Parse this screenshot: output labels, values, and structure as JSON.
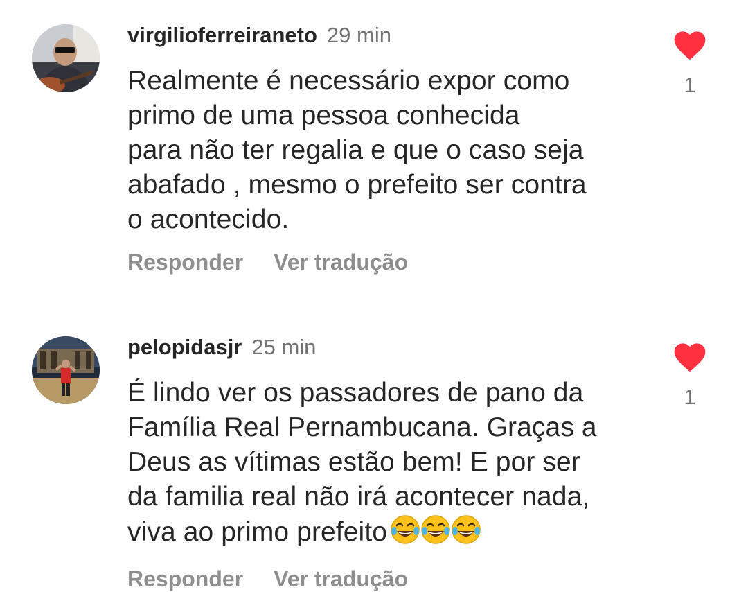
{
  "comments": [
    {
      "username": "virgilioferreiraneto",
      "time": "29 min",
      "lines": [
        "Realmente é necessário expor como",
        "primo de uma pessoa conhecida",
        "para não ter regalia e que o caso seja",
        "abafado , mesmo o prefeito ser contra",
        "o acontecido."
      ],
      "reply_label": "Responder",
      "translate_label": "Ver tradução",
      "like_count": "1",
      "liked": true,
      "like_color": "#ff3040"
    },
    {
      "username": "pelopidasjr",
      "time": "25 min",
      "lines": [
        "É lindo ver os passadores de pano da",
        "Família Real Pernambucana. Graças a",
        "Deus as vítimas estão bem! E por ser",
        "da familia real não irá acontecer nada,",
        "viva ao primo prefeito"
      ],
      "emoji": "😂😂😂",
      "reply_label": "Responder",
      "translate_label": "Ver tradução",
      "like_count": "1",
      "liked": true,
      "like_color": "#ff3040"
    }
  ],
  "icons": {
    "like": "heart-filled-icon",
    "emoji": "face-with-tears-of-joy"
  }
}
